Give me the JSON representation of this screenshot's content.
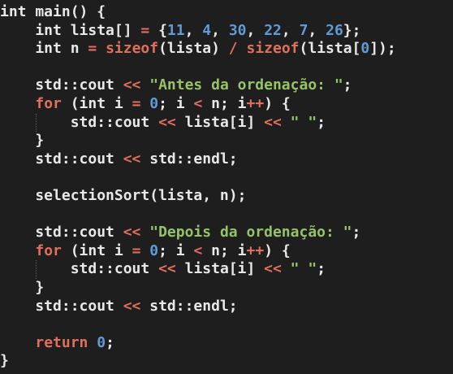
{
  "editor": {
    "language": "cpp",
    "colors": {
      "background": "#1e1e1e",
      "text": "#e8e8e8",
      "keyword_control": "#e0705c",
      "number": "#5f9bd6",
      "string": "#96c36a",
      "indent_guide": "#5a5a5a"
    },
    "lines": [
      {
        "segments": [
          {
            "t": "int main() {",
            "c": "txt"
          }
        ]
      },
      {
        "segments": [
          {
            "t": "    int lista[] ",
            "c": "txt"
          },
          {
            "t": "=",
            "c": "op"
          },
          {
            "t": " {",
            "c": "txt"
          },
          {
            "t": "11",
            "c": "num"
          },
          {
            "t": ", ",
            "c": "txt"
          },
          {
            "t": "4",
            "c": "num"
          },
          {
            "t": ", ",
            "c": "txt"
          },
          {
            "t": "30",
            "c": "num"
          },
          {
            "t": ", ",
            "c": "txt"
          },
          {
            "t": "22",
            "c": "num"
          },
          {
            "t": ", ",
            "c": "txt"
          },
          {
            "t": "7",
            "c": "num"
          },
          {
            "t": ", ",
            "c": "txt"
          },
          {
            "t": "26",
            "c": "num"
          },
          {
            "t": "};",
            "c": "txt"
          }
        ]
      },
      {
        "segments": [
          {
            "t": "    int n ",
            "c": "txt"
          },
          {
            "t": "=",
            "c": "op"
          },
          {
            "t": " ",
            "c": "txt"
          },
          {
            "t": "sizeof",
            "c": "ctl"
          },
          {
            "t": "(lista) ",
            "c": "txt"
          },
          {
            "t": "/",
            "c": "op"
          },
          {
            "t": " ",
            "c": "txt"
          },
          {
            "t": "sizeof",
            "c": "ctl"
          },
          {
            "t": "(lista[",
            "c": "txt"
          },
          {
            "t": "0",
            "c": "num"
          },
          {
            "t": "]);",
            "c": "txt"
          }
        ]
      },
      {
        "segments": []
      },
      {
        "segments": [
          {
            "t": "    std::cout ",
            "c": "txt"
          },
          {
            "t": "<<",
            "c": "op"
          },
          {
            "t": " ",
            "c": "txt"
          },
          {
            "t": "\"Antes da ordenação: \"",
            "c": "str"
          },
          {
            "t": ";",
            "c": "txt"
          }
        ]
      },
      {
        "segments": [
          {
            "t": "    ",
            "c": "txt"
          },
          {
            "t": "for",
            "c": "ctl"
          },
          {
            "t": " (int i ",
            "c": "txt"
          },
          {
            "t": "=",
            "c": "op"
          },
          {
            "t": " ",
            "c": "txt"
          },
          {
            "t": "0",
            "c": "num"
          },
          {
            "t": "; i ",
            "c": "txt"
          },
          {
            "t": "<",
            "c": "op"
          },
          {
            "t": " n; i",
            "c": "txt"
          },
          {
            "t": "++",
            "c": "op"
          },
          {
            "t": ") {",
            "c": "txt"
          }
        ]
      },
      {
        "segments": [
          {
            "t": "        std::cout ",
            "c": "txt"
          },
          {
            "t": "<<",
            "c": "op"
          },
          {
            "t": " lista[i] ",
            "c": "txt"
          },
          {
            "t": "<<",
            "c": "op"
          },
          {
            "t": " ",
            "c": "txt"
          },
          {
            "t": "\" \"",
            "c": "str"
          },
          {
            "t": ";",
            "c": "txt"
          }
        ],
        "guide": true
      },
      {
        "segments": [
          {
            "t": "    }",
            "c": "txt"
          }
        ]
      },
      {
        "segments": [
          {
            "t": "    std::cout ",
            "c": "txt"
          },
          {
            "t": "<<",
            "c": "op"
          },
          {
            "t": " std::endl;",
            "c": "txt"
          }
        ]
      },
      {
        "segments": []
      },
      {
        "segments": [
          {
            "t": "    selectionSort(lista, n);",
            "c": "txt"
          }
        ]
      },
      {
        "segments": []
      },
      {
        "segments": [
          {
            "t": "    std::cout ",
            "c": "txt"
          },
          {
            "t": "<<",
            "c": "op"
          },
          {
            "t": " ",
            "c": "txt"
          },
          {
            "t": "\"Depois da ordenação: \"",
            "c": "str"
          },
          {
            "t": ";",
            "c": "txt"
          }
        ]
      },
      {
        "segments": [
          {
            "t": "    ",
            "c": "txt"
          },
          {
            "t": "for",
            "c": "ctl"
          },
          {
            "t": " (int i ",
            "c": "txt"
          },
          {
            "t": "=",
            "c": "op"
          },
          {
            "t": " ",
            "c": "txt"
          },
          {
            "t": "0",
            "c": "num"
          },
          {
            "t": "; i ",
            "c": "txt"
          },
          {
            "t": "<",
            "c": "op"
          },
          {
            "t": " n; i",
            "c": "txt"
          },
          {
            "t": "++",
            "c": "op"
          },
          {
            "t": ") {",
            "c": "txt"
          }
        ]
      },
      {
        "segments": [
          {
            "t": "        std::cout ",
            "c": "txt"
          },
          {
            "t": "<<",
            "c": "op"
          },
          {
            "t": " lista[i] ",
            "c": "txt"
          },
          {
            "t": "<<",
            "c": "op"
          },
          {
            "t": " ",
            "c": "txt"
          },
          {
            "t": "\" \"",
            "c": "str"
          },
          {
            "t": ";",
            "c": "txt"
          }
        ],
        "guide": true
      },
      {
        "segments": [
          {
            "t": "    }",
            "c": "txt"
          }
        ]
      },
      {
        "segments": [
          {
            "t": "    std::cout ",
            "c": "txt"
          },
          {
            "t": "<<",
            "c": "op"
          },
          {
            "t": " std::endl;",
            "c": "txt"
          }
        ]
      },
      {
        "segments": []
      },
      {
        "segments": [
          {
            "t": "    ",
            "c": "txt"
          },
          {
            "t": "return",
            "c": "ctl"
          },
          {
            "t": " ",
            "c": "txt"
          },
          {
            "t": "0",
            "c": "num"
          },
          {
            "t": ";",
            "c": "txt"
          }
        ]
      },
      {
        "segments": [
          {
            "t": "}",
            "c": "txt"
          }
        ]
      }
    ]
  }
}
